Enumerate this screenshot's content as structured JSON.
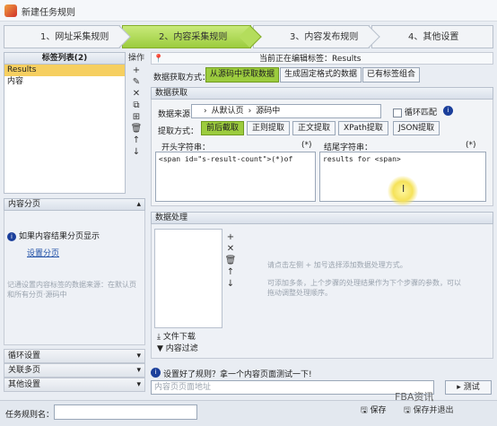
{
  "window": {
    "title": "新建任务规则"
  },
  "steps": [
    {
      "label": "1、网址采集规则"
    },
    {
      "label": "2、内容采集规则"
    },
    {
      "label": "3、内容发布规则"
    },
    {
      "label": "4、其他设置"
    }
  ],
  "tag_list": {
    "header": "标签列表(2)",
    "items": [
      "Results",
      "内容"
    ]
  },
  "operations": {
    "header": "操作",
    "buttons": [
      "+",
      "✎",
      "✕",
      "⧉",
      "⊞",
      "🗑",
      "↑",
      "↓"
    ]
  },
  "page_section": {
    "header": "内容分页",
    "info": "如果内容结果分页显示",
    "link": "设置分页",
    "note": "记通设置内容标签的数据来源：在默认页和所有分页·源码中"
  },
  "left_collapsed": [
    "循环设置",
    "关联多页",
    "其他设置"
  ],
  "editing": {
    "label": "当前正在编辑标签：Results"
  },
  "data_mode": {
    "label": "数据获取方式：",
    "options": [
      "从源码中获取数据",
      "生成固定格式的数据",
      "已有标签组合"
    ]
  },
  "extract": {
    "header": "数据获取",
    "source_label": "数据来源：",
    "source_parts": [
      "从默认页",
      "源码中"
    ],
    "loop_match": "循环匹配",
    "method_label": "提取方式：",
    "methods": [
      "前后截取",
      "正则提取",
      "正文提取",
      "XPath提取",
      "JSON提取"
    ],
    "start_label": "开头字符串：",
    "start_star": "(*)",
    "start_value": "<span id=\"s-result-count\">(*)of",
    "end_label": "结尾字符串：",
    "end_star": "(*)",
    "end_value": "results for <span>"
  },
  "processing": {
    "header": "数据处理",
    "tip": "请点击左侧 + 加号选择添加数据处理方式。",
    "tip2": "可添加多条，上个步骤的处理结果作为下个步骤的参数，可以拖动调整处理顺序。",
    "side_buttons": [
      "+",
      "✕",
      "🗑",
      "↑",
      "↓"
    ],
    "actions": [
      "文件下载",
      "内容过滤"
    ]
  },
  "test": {
    "hint": "设置好了规则？拿一个内容页面测试一下!",
    "url_placeholder": "内容页页面地址",
    "button": "测试"
  },
  "bottom": {
    "rule_name_label": "任务规则名：",
    "save": "保存",
    "save_exit": "保存并退出",
    "watermark": "FBA资讯"
  }
}
